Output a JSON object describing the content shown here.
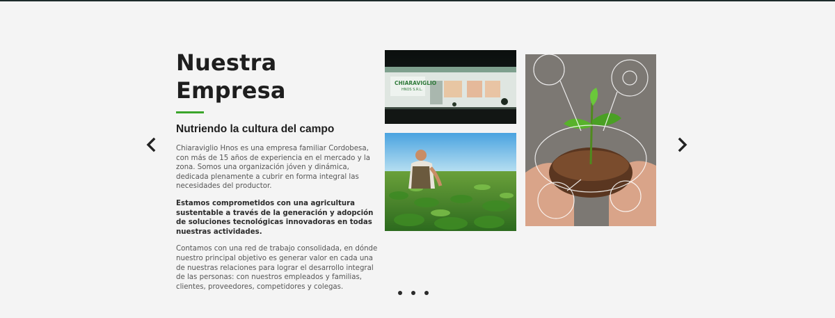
{
  "section": {
    "title": "Nuestra Empresa",
    "subtitle": "Nutriendo la cultura del campo",
    "paragraphs": [
      "Chiaraviglio Hnos es una empresa familiar Cordobesa, con más de 15 años de experiencia en el mercado y la zona. Somos una organización jóven y dinámica, dedicada plenamente a cubrir en forma integral las necesidades del productor.",
      "Estamos comprometidos con una agricultura sustentable a través de la generación y adopción de soluciones tecnológicas innovadoras en todas nuestras actividades.",
      "Contamos con una red de trabajo consolidada, en dónde nuestro principal objetivo es generar valor en cada una de nuestras relaciones para lograr el desarrollo integral de las personas: con nuestros empleados y familias, clientes, proveedores, competidores y colegas."
    ]
  },
  "images": {
    "building": {
      "sign_line1": "CHIARAVIGLIO",
      "sign_line2": "HNOS S.R.L."
    },
    "farmer": {},
    "sprout": {}
  },
  "carousel": {
    "prev_icon": "chevron-left-icon",
    "next_icon": "chevron-right-icon",
    "dot_count": 3
  },
  "colors": {
    "accent": "#3aa52b",
    "background": "#f4f4f4",
    "text_dark": "#1e1e1e",
    "text_body": "#555555"
  }
}
